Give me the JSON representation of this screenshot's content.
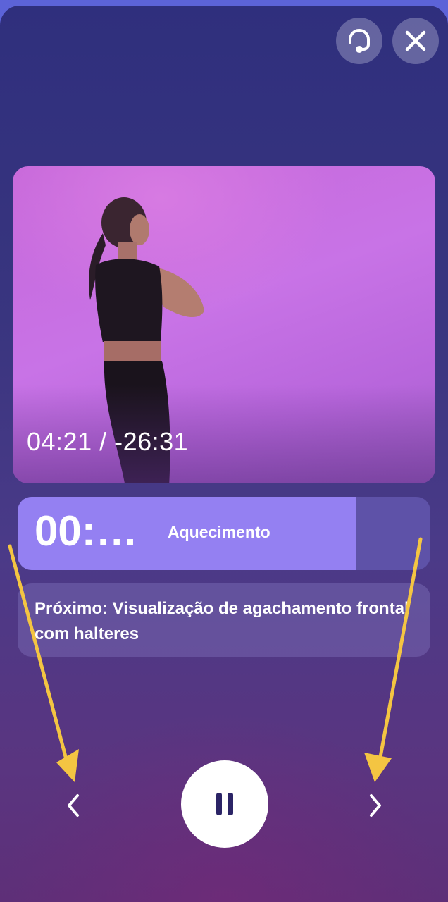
{
  "header": {
    "support_icon": "headset-icon",
    "close_icon": "close-icon"
  },
  "video": {
    "timecode": "04:21 / -26:31"
  },
  "current_step": {
    "time": "00:…",
    "label": "Aquecimento",
    "progress": 0.82
  },
  "next_step": {
    "text": "Próximo: Visualização de agachamento frontal com halteres"
  },
  "controls": {
    "prev_icon": "chevron-left-icon",
    "pause_icon": "pause-icon",
    "next_icon": "chevron-right-icon"
  },
  "colors": {
    "accent": "#9480f2",
    "annotation_arrow": "#f4c542",
    "pause_icon": "#2b2466"
  }
}
